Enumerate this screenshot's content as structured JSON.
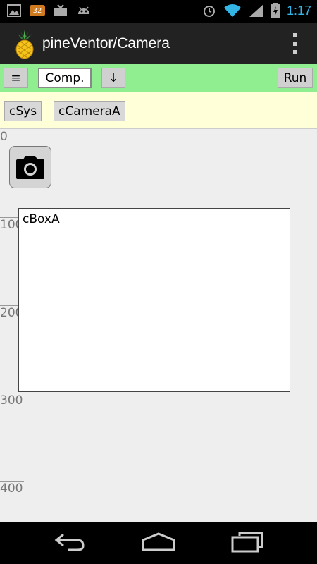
{
  "status_bar": {
    "badge": "32",
    "time": "1:17",
    "icons": [
      "gallery-icon",
      "notification-badge",
      "tv-icon",
      "android-icon",
      "alarm-icon",
      "wifi-icon",
      "signal-icon",
      "battery-icon"
    ]
  },
  "action_bar": {
    "title": "pineVentor/Camera",
    "logo": "pineapple-logo",
    "overflow": "overflow-menu-icon"
  },
  "toolbar": {
    "menu_label": "≡",
    "comp_label": "Comp.",
    "down_label": "↓",
    "run_label": "Run"
  },
  "components": {
    "sys_label": "cSys",
    "camera_label": "cCameraA"
  },
  "canvas": {
    "ruler_labels": [
      "0",
      "100",
      "200",
      "300",
      "400"
    ],
    "camera_component_icon": "camera-icon",
    "box_label": "cBoxA"
  },
  "nav_bar": {
    "icons": [
      "back-icon",
      "home-icon",
      "recents-icon"
    ]
  },
  "colors": {
    "toolbar_bg": "#90ee90",
    "compbar_bg": "#ffffd8",
    "clock": "#33b5e5",
    "canvas_bg": "#eeeeee"
  }
}
